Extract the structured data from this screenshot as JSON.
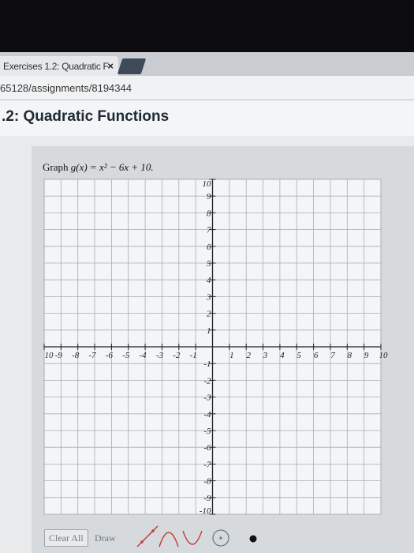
{
  "browser": {
    "tab_title": "Exercises 1.2: Quadratic F",
    "tab_close": "×",
    "url": "65128/assignments/8194344"
  },
  "page": {
    "title": ".2: Quadratic Functions"
  },
  "problem": {
    "prefix": "Graph",
    "equation": "g(x) = x² − 6x + 10."
  },
  "chart_data": {
    "type": "line",
    "xlim": [
      -10,
      10
    ],
    "ylim": [
      -10,
      10
    ],
    "grid": true,
    "x_tick_labels": [
      "10",
      "-9",
      "-8",
      "-7",
      "-6",
      "-5",
      "-4",
      "-3",
      "-2",
      "-1",
      "1",
      "2",
      "3",
      "4",
      "5",
      "6",
      "7",
      "8",
      "9",
      "10"
    ],
    "x_tick_values": [
      -10,
      -9,
      -8,
      -7,
      -6,
      -5,
      -4,
      -3,
      -2,
      -1,
      1,
      2,
      3,
      4,
      5,
      6,
      7,
      8,
      9,
      10
    ],
    "y_tick_labels": [
      "10",
      "9",
      "8",
      "7",
      "6",
      "5",
      "4",
      "3",
      "2",
      "1",
      "-1",
      "-2",
      "-3",
      "-4",
      "-5",
      "-6",
      "-7",
      "-8",
      "-9",
      "-10"
    ],
    "y_tick_values": [
      10,
      9,
      8,
      7,
      6,
      5,
      4,
      3,
      2,
      1,
      -1,
      -2,
      -3,
      -4,
      -5,
      -6,
      -7,
      -8,
      -9,
      -10
    ],
    "series": []
  },
  "toolbar": {
    "clear_all_label": "Clear All",
    "draw_label": "Draw",
    "tools": [
      "line-tool-icon",
      "parabola-up-tool-icon",
      "parabola-down-tool-icon",
      "circle-tool-icon",
      "point-tool-icon"
    ]
  },
  "colors": {
    "axis": "#1f2326",
    "grid": "#a8adb2",
    "plot_bg": "#f4f5f6",
    "tool_red": "#c23b3b"
  }
}
